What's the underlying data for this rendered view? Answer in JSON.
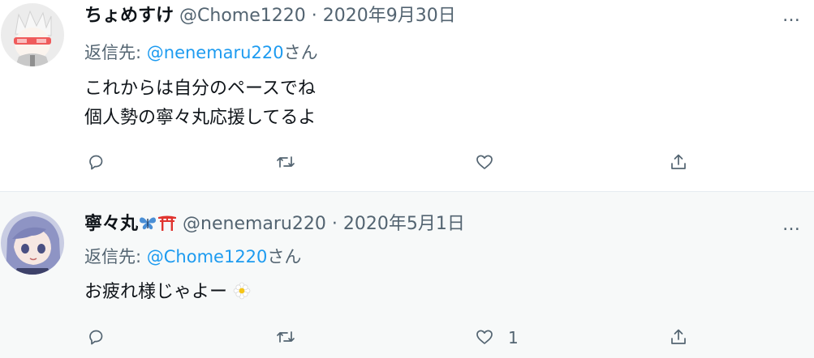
{
  "tweets": [
    {
      "display_name": "ちょめすけ",
      "handle": "@Chome1220",
      "separator": "·",
      "date": "2020年9月30日",
      "reply_prefix": "返信先:",
      "reply_mention": "@nenemaru220",
      "reply_suffix": "さん",
      "text_lines": [
        "これからは自分のペースでね",
        "個人勢の寧々丸応援してるよ"
      ],
      "more": "…",
      "like_count": ""
    },
    {
      "display_name": "寧々丸",
      "name_emoji": [
        "butterfly-emoji",
        "torii-emoji"
      ],
      "handle": "@nenemaru220",
      "separator": "·",
      "date": "2020年5月1日",
      "reply_prefix": "返信先:",
      "reply_mention": "@Chome1220",
      "reply_suffix": "さん",
      "text": "お疲れ様じゃよー",
      "text_emoji": "flower-emoji",
      "more": "…",
      "like_count": "1"
    }
  ],
  "colors": {
    "text": "#0f1419",
    "secondary": "#536471",
    "mention": "#1d9bf0",
    "hover_bg": "#f7f9f9"
  }
}
